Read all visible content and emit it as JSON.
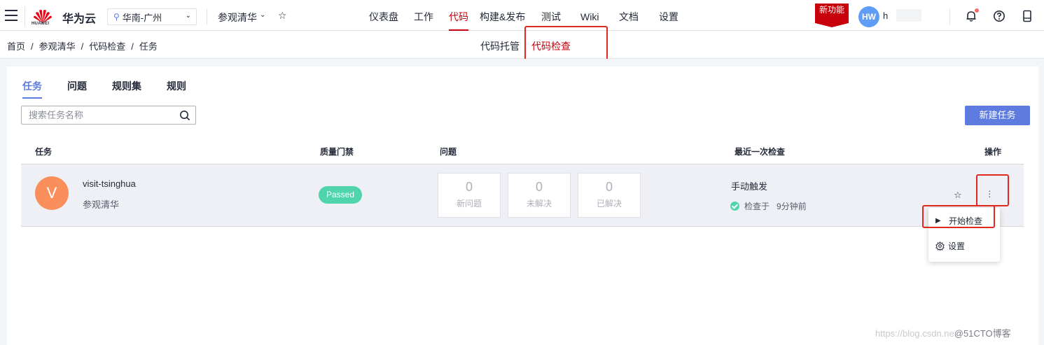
{
  "topbar": {
    "brand": "华为云",
    "logo_text": "HUAWEI",
    "region": "华南-广州",
    "project": "参观清华",
    "nav": [
      "仪表盘",
      "工作",
      "代码",
      "构建&发布",
      "测试",
      "Wiki",
      "文档",
      "设置"
    ],
    "active_nav": "代码",
    "new_feature": "新功能",
    "avatar_initials": "HW",
    "user_name": "h"
  },
  "breadcrumb": [
    "首页",
    "参观清华",
    "代码检查",
    "任务"
  ],
  "subnav": [
    "代码托管",
    "代码检查"
  ],
  "tabs": [
    "任务",
    "问题",
    "规则集",
    "规则"
  ],
  "search": {
    "placeholder": "搜索任务名称"
  },
  "new_task_button": "新建任务",
  "table": {
    "headers": [
      "任务",
      "质量门禁",
      "问题",
      "最近一次检查",
      "操作"
    ],
    "row": {
      "avatar": "V",
      "name": "visit-tsinghua",
      "project": "参观清华",
      "gate": "Passed",
      "stats": [
        {
          "value": "0",
          "label": "新问题"
        },
        {
          "value": "0",
          "label": "未解决"
        },
        {
          "value": "0",
          "label": "已解决"
        }
      ],
      "trigger": "手动触发",
      "checked_label": "检查于",
      "checked_time": "9分钟前"
    }
  },
  "menu": {
    "start": "开始检查",
    "settings": "设置"
  },
  "watermark": {
    "url": "https://blog.csdn.ne",
    "site": "@51CTO博客"
  },
  "colors": {
    "brand_red": "#c7000b",
    "primary": "#5e7ce0",
    "success": "#50d4ab",
    "avatar_orange": "#fa8f5b"
  }
}
